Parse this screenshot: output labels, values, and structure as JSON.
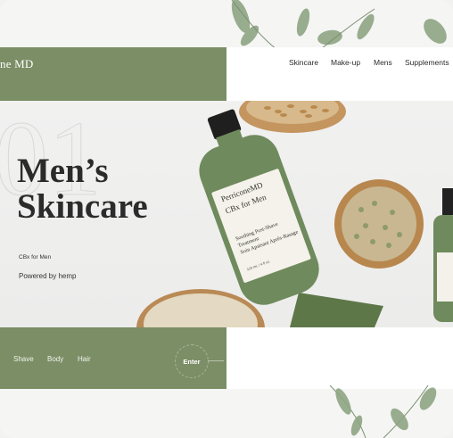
{
  "brand": {
    "logo_text": "ne MD"
  },
  "nav": {
    "items": [
      "Skincare",
      "Make-up",
      "Mens",
      "Supplements"
    ]
  },
  "hero": {
    "index_number": "01",
    "title_line1": "Men’s",
    "title_line2": "Skincare",
    "product_tag": "CBx for Men",
    "powered_by": "Powered by hemp",
    "bottle_brand": "PerriconeMD",
    "bottle_line": "CBx for Men",
    "bottle_desc1": "Soothing Post-Shave",
    "bottle_desc2": "Treatment",
    "bottle_desc3": "Soin Apaisant Après-Rasage",
    "bottle_volume": "118 mL / 4 fl oz"
  },
  "footer": {
    "categories": [
      "Shave",
      "Body",
      "Hair"
    ],
    "enter_label": "Enter"
  },
  "colors": {
    "accent": "#7b8e66",
    "bottle": "#6f8a5c",
    "text_dark": "#2b2b2b"
  }
}
